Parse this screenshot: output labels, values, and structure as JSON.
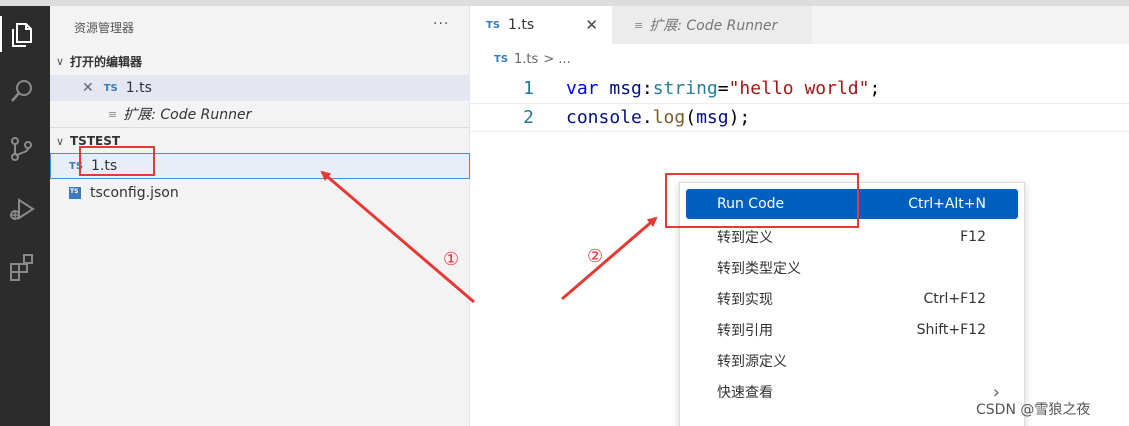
{
  "sidebar": {
    "title": "资源管理器",
    "more": "···",
    "open_editors": {
      "header": "打开的编辑器",
      "items": [
        {
          "close": "✕",
          "badge": "TS",
          "label": "1.ts"
        },
        {
          "label": "扩展: Code Runner"
        }
      ]
    },
    "project": {
      "header": "TSTEST",
      "files": [
        {
          "badge": "TS",
          "label": "1.ts"
        },
        {
          "badge": "TS",
          "label": "tsconfig.json"
        }
      ]
    }
  },
  "editor": {
    "tabs": [
      {
        "badge": "TS",
        "label": "1.ts",
        "close": "✕"
      },
      {
        "label": "扩展: Code Runner"
      }
    ],
    "breadcrumb": {
      "badge": "TS",
      "file": "1.ts",
      "rest": "> ..."
    },
    "lines": [
      {
        "num": "1"
      },
      {
        "num": "2"
      }
    ]
  },
  "context_menu": {
    "items": [
      {
        "label": "Run Code",
        "shortcut": "Ctrl+Alt+N"
      },
      {
        "label": "转到定义",
        "shortcut": "F12"
      },
      {
        "label": "转到类型定义",
        "shortcut": ""
      },
      {
        "label": "转到实现",
        "shortcut": "Ctrl+F12"
      },
      {
        "label": "转到引用",
        "shortcut": "Shift+F12"
      },
      {
        "label": "转到源定义",
        "shortcut": ""
      },
      {
        "label": "快速查看",
        "shortcut": "›"
      }
    ]
  },
  "annotations": {
    "step1": "①",
    "step2": "②",
    "color": "#e53935"
  },
  "watermark": "CSDN @雪狼之夜",
  "icons": {
    "activity": [
      "files-icon",
      "search-icon",
      "source-control-icon",
      "run-debug-icon",
      "extensions-icon"
    ]
  }
}
